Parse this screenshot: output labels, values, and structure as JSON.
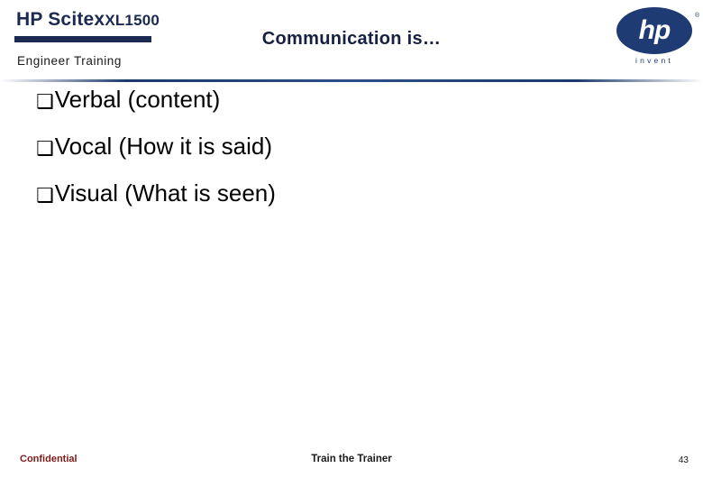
{
  "header": {
    "product_logo_main": "HP Scitex",
    "product_logo_model": "XL1500",
    "subtitle": "Engineer Training",
    "slide_title": "Communication is…",
    "brand": {
      "letters": "hp",
      "tagline": "invent",
      "registered": "®",
      "color": "#1f3b73"
    }
  },
  "bullets": [
    {
      "marker": "❑",
      "text": "Verbal (content)"
    },
    {
      "marker": "❑",
      "text": "Vocal (How it is said)"
    },
    {
      "marker": "❑",
      "text": "Visual (What is seen)"
    }
  ],
  "footer": {
    "confidential": "Confidential",
    "center": "Train the Trainer",
    "page_number": "43",
    "confidential_color": "#7b1a1a"
  }
}
